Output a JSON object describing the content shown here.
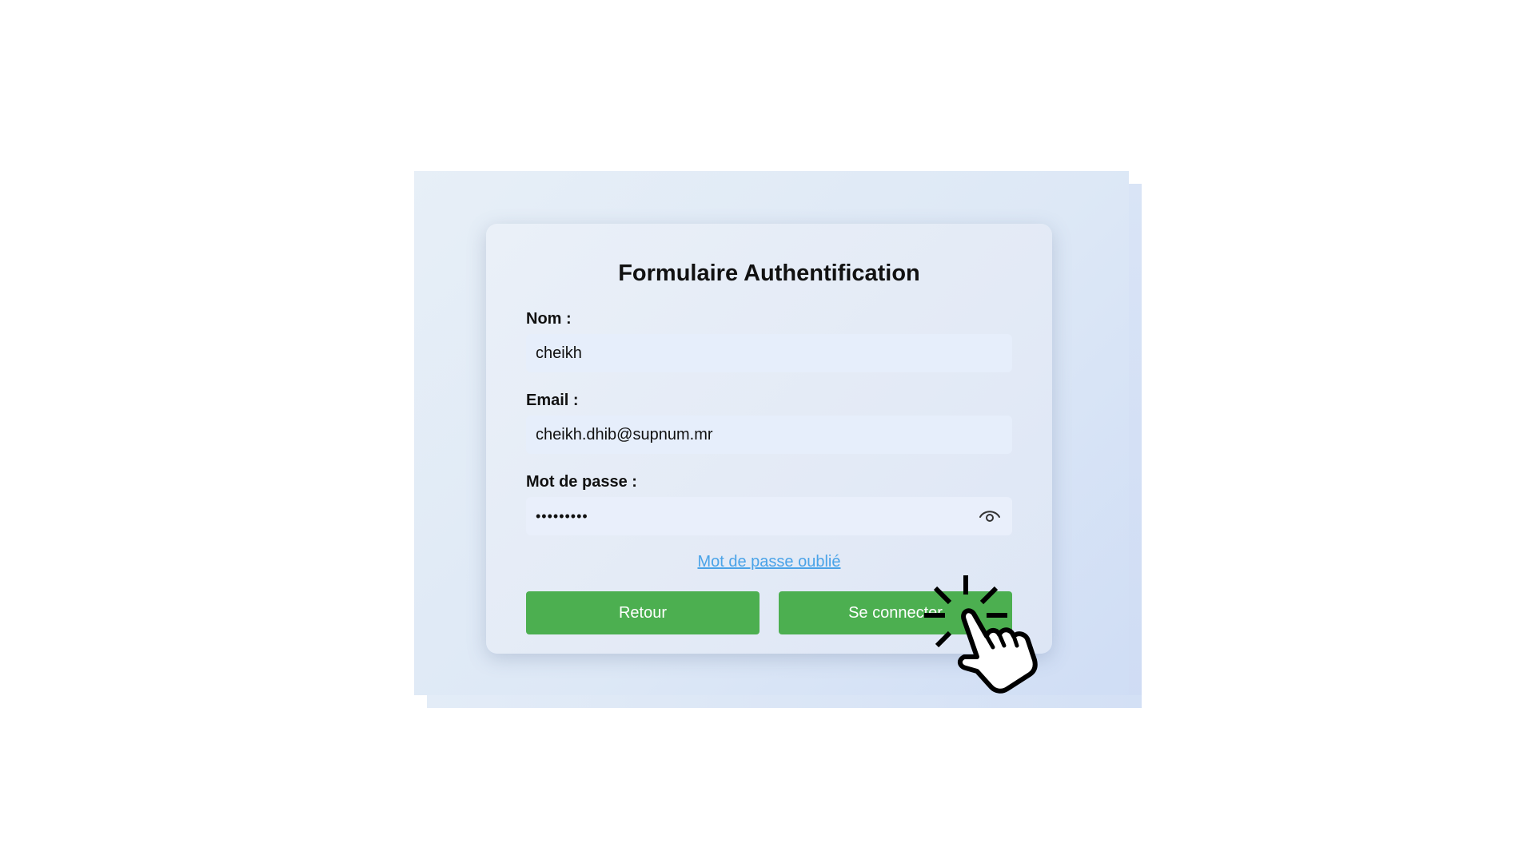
{
  "form": {
    "title": "Formulaire Authentification",
    "name_label": "Nom :",
    "name_value": "cheikh",
    "email_label": "Email :",
    "email_value": "cheikh.dhib@supnum.mr",
    "password_label": "Mot de passe :",
    "password_value": "•••••••••",
    "password_icon": "eye-icon",
    "forgot_link": "Mot de passe oublié",
    "back_button": "Retour",
    "login_button": "Se connecter"
  },
  "overlay": {
    "icon": "click-hand-icon"
  },
  "colors": {
    "button": "#4caf50",
    "link": "#4aa3e8",
    "field_bg": "#e6eefb",
    "card_bg": "#e3eaf6"
  }
}
